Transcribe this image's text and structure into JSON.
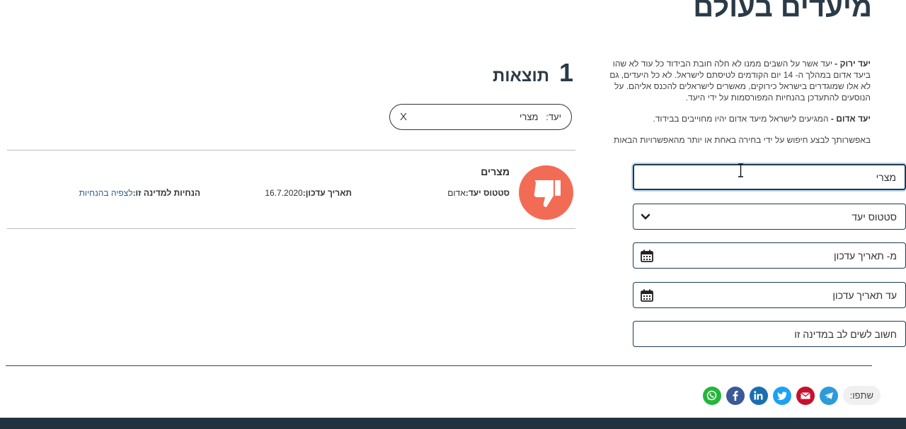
{
  "page": {
    "title": "מיעדים בעולם"
  },
  "filters": {
    "green_label": "יעד ירוק -",
    "green_text": " יעד אשר על השבים ממנו לא חלה חובת הבידוד כל עוד לא שהו ביעד אדום במהלך ה- 14 יום הקודמים לטיסתם לישראל. לא כל היעדים, גם לא אלו שמוגדרים בישראל כירוקים, מאשרים לישראלים להכנס אליהם. על הנוסעים להתעדכן בהנחיות המפורסמות על ידי היעד.",
    "red_label": "יעד אדום -",
    "red_text": " המגיעים לישראל מיעד אדום יהיו מחוייבים בבידוד.",
    "search_hint": "באפשרותך לבצע חיפוש על ידי בחירה באחת או יותר מהאפשרויות הבאות",
    "destination_value": "מצרי",
    "status_label": "סטטוס יעד",
    "from_date_label": "מ- תאריך עדכון",
    "to_date_label": "עד תאריך עדכון",
    "attention_label": "חשוב לשים לב במדינה זו"
  },
  "results": {
    "count": "1",
    "label": "תוצאות",
    "chip_key": "יעד:",
    "chip_value": "מצרי",
    "chip_close": "X",
    "items": [
      {
        "country": "מצרים",
        "status_key": "סטטוס יעד:",
        "status_value": "אדום",
        "date_key": "תאריך עדכון:",
        "date_value": "16.7.2020",
        "guide_key": "הנחיות למדינה זו:",
        "guide_link": "לצפיה בהנחיות"
      }
    ]
  },
  "share": {
    "label": "שתפו:",
    "networks": [
      {
        "name": "telegram",
        "color": "#2e9bd9",
        "glyph": "➤"
      },
      {
        "name": "email",
        "color": "#c8102e",
        "glyph": "✉"
      },
      {
        "name": "twitter",
        "color": "#1da1f2",
        "glyph": "t"
      },
      {
        "name": "linkedin",
        "color": "#1a6fb0",
        "glyph": "in"
      },
      {
        "name": "facebook",
        "color": "#3b5998",
        "glyph": "f"
      },
      {
        "name": "whatsapp",
        "color": "#25b53b",
        "glyph": "✆"
      }
    ]
  },
  "colors": {
    "navy": "#1e3a52",
    "thumb_red": "#f26c55",
    "footer": "#22333f"
  }
}
